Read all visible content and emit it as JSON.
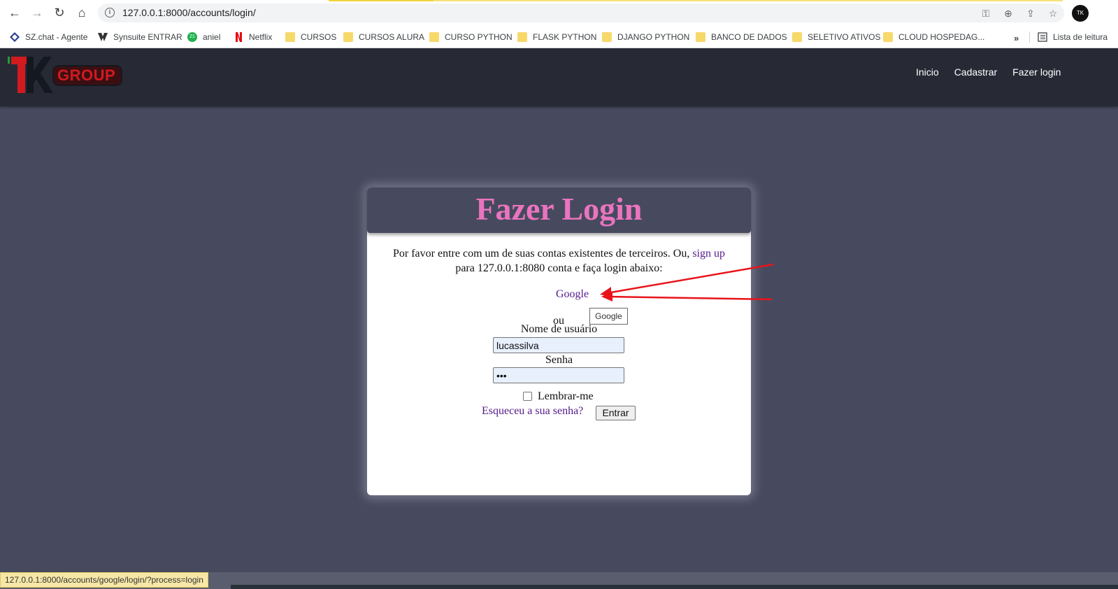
{
  "browser": {
    "url": "127.0.0.1:8000/accounts/login/",
    "profile_initials": "TK",
    "status_url": "127.0.0.1:8000/accounts/google/login/?process=login",
    "bookmarks": [
      {
        "label": "SZ.chat - Agente",
        "icon": "diamond-icon"
      },
      {
        "label": "Synsuite ENTRAR",
        "icon": "synsuite-icon"
      },
      {
        "label": "aniel",
        "icon": "circle-badge-icon",
        "badge": "21"
      },
      {
        "label": "Netflix",
        "icon": "netflix-icon"
      },
      {
        "label": "CURSOS",
        "icon": "folder-icon"
      },
      {
        "label": "CURSOS ALURA",
        "icon": "folder-icon"
      },
      {
        "label": "CURSO PYTHON",
        "icon": "folder-icon"
      },
      {
        "label": "FLASK PYTHON",
        "icon": "folder-icon"
      },
      {
        "label": "DJANGO PYTHON",
        "icon": "folder-icon"
      },
      {
        "label": "BANCO DE DADOS",
        "icon": "folder-icon"
      },
      {
        "label": "SELETIVO ATIVOS",
        "icon": "folder-icon"
      },
      {
        "label": "CLOUD HOSPEDAG...",
        "icon": "folder-icon"
      }
    ],
    "bookmarks_more": "»",
    "reading_list": "Lista de leitura"
  },
  "site": {
    "logo_text": "GROUP",
    "logo_mark": "TK",
    "nav": [
      "Inicio",
      "Cadastrar",
      "Fazer login"
    ]
  },
  "login": {
    "title": "Fazer Login",
    "intro_before": "Por favor entre com um de suas contas existentes de terceiros. Ou, ",
    "signup_link": "sign up",
    "intro_after": "para 127.0.0.1:8080 conta e faça login abaixo:",
    "google_link": "Google",
    "tooltip": "Google",
    "or": "ou",
    "username_label": "Nome de usuário",
    "username_value": "lucassilva",
    "password_label": "Senha",
    "password_value": "•••",
    "remember_label": "Lembrar-me",
    "forgot_link": "Esqueceu a sua senha?",
    "submit": "Entrar"
  },
  "colors": {
    "page_bg": "#474a5e",
    "navbar_bg": "#272a35",
    "title_pink": "#ea74bf",
    "link_purple": "#551a8b",
    "arrow_red": "#e8141a"
  }
}
